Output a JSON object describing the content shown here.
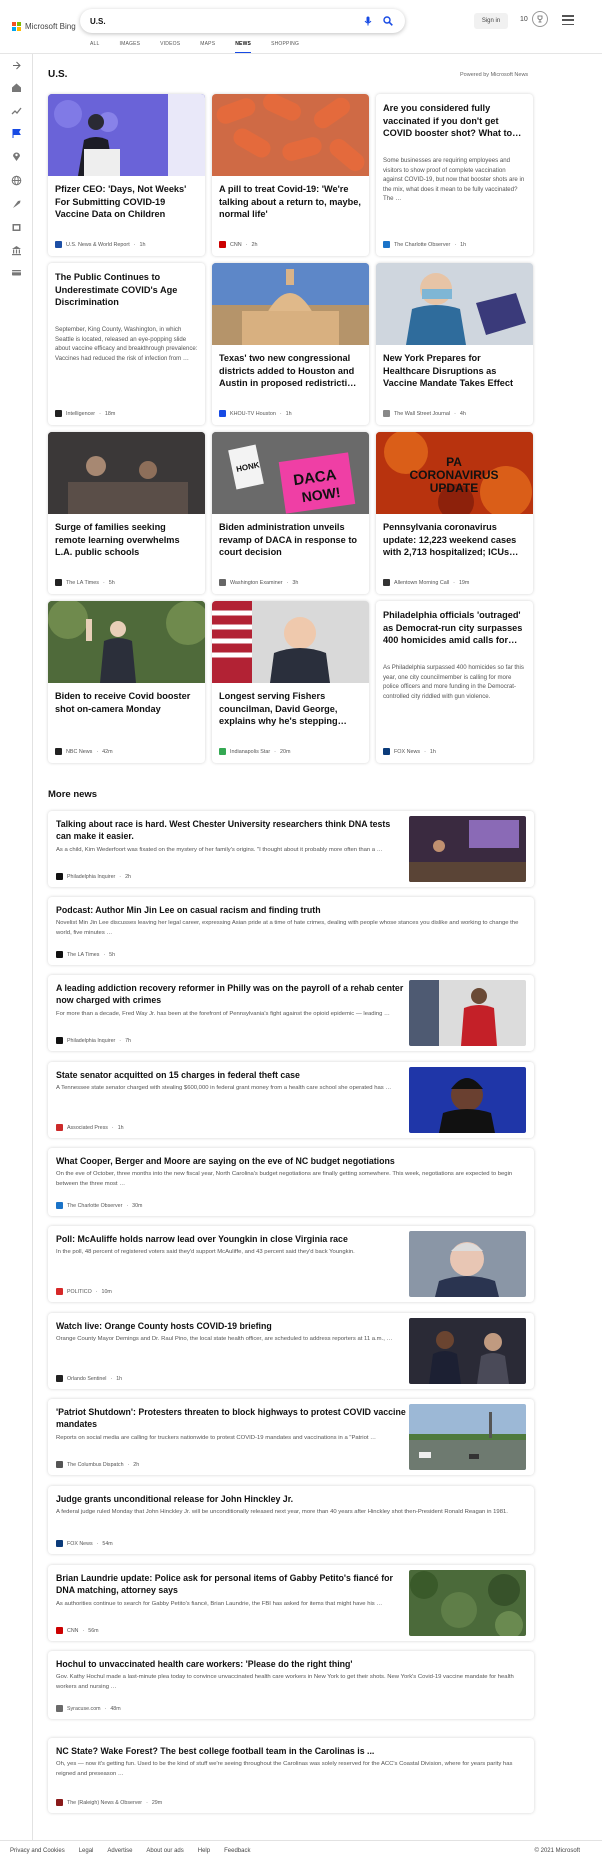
{
  "brand": {
    "name": "Microsoft Bing",
    "colors": [
      "#f25022",
      "#7fba00",
      "#00a4ef",
      "#ffb900"
    ]
  },
  "search": {
    "query": "U.S."
  },
  "header": {
    "sign_in": "Sign in",
    "rewards_count": "10"
  },
  "tabs": [
    {
      "label": "ALL",
      "active": false
    },
    {
      "label": "IMAGES",
      "active": false
    },
    {
      "label": "VIDEOS",
      "active": false
    },
    {
      "label": "MAPS",
      "active": false
    },
    {
      "label": "NEWS",
      "active": true
    },
    {
      "label": "SHOPPING",
      "active": false
    }
  ],
  "rail_icons": [
    "collapse-arrow-icon",
    "home-icon",
    "trending-icon",
    "flag-icon",
    "location-icon",
    "globe-icon",
    "rocket-icon",
    "entertainment-icon",
    "finance-icon",
    "money-icon"
  ],
  "section": {
    "title": "U.S.",
    "powered_by": "Powered by Microsoft News"
  },
  "accent": "#174ae4",
  "cards": [
    {
      "title": "Pfizer CEO: 'Days, Not Weeks' For Submitting COVID-19 Vaccine Data on Children",
      "source": "U.S. News & World Report",
      "time": "1h",
      "image": "pfizer-ceo"
    },
    {
      "title": "A pill to treat Covid-19: 'We're talking about a return to, maybe, normal life'",
      "source": "CNN",
      "time": "2h",
      "image": "pills"
    },
    {
      "title": "Are you considered fully vaccinated if you don't get COVID booster shot? What to…",
      "snippet": "Some businesses are requiring employees and visitors to show proof of complete vaccination against COVID-19, but now that booster shots are in the mix, what does it mean to be fully vaccinated? The …",
      "source": "The Charlotte Observer",
      "time": "1h"
    },
    {
      "title": "The Public Continues to Underestimate COVID's Age Discrimination",
      "snippet": "September, King County, Washington, in which Seattle is located, released an eye-popping slide about vaccine efficacy and breakthrough prevalence: Vaccines had reduced the risk of infection from …",
      "source": "Intelligencer",
      "time": "18m"
    },
    {
      "title": "Texas' two new congressional districts added to Houston and Austin in proposed redistricti…",
      "source": "KHOU-TV Houston",
      "time": "1h",
      "image": "capitol"
    },
    {
      "title": "New York Prepares for Healthcare Disruptions as Vaccine Mandate Takes Effect",
      "source": "The Wall Street Journal",
      "time": "4h",
      "image": "nurse"
    },
    {
      "title": "Surge of families seeking remote learning overwhelms L.A. public schools",
      "source": "The LA Times",
      "time": "5h",
      "image": "classroom"
    },
    {
      "title": "Biden administration unveils revamp of DACA in response to court decision",
      "source": "Washington Examiner",
      "time": "3h",
      "image": "daca"
    },
    {
      "title": "Pennsylvania coronavirus update: 12,223 weekend cases with 2,713 hospitalized; ICUs…",
      "source": "Allentown Morning Call",
      "time": "19m",
      "image": "pa-covid",
      "image_text": "PA CORONAVIRUS UPDATE"
    },
    {
      "title": "Biden to receive Covid booster shot on-camera Monday",
      "source": "NBC News",
      "time": "42m",
      "image": "biden"
    },
    {
      "title": "Longest serving Fishers councilman, David George, explains why he's stepping…",
      "source": "Indianapolis Star",
      "time": "20m",
      "image": "councilman"
    },
    {
      "title": "Philadelphia officials 'outraged' as Democrat-run city surpasses 400 homicides amid calls for…",
      "snippet": "As Philadelphia surpassed 400 homicides so far this year, one city councilmember is calling for more police officers and more funding in the Democrat-controlled city riddled with gun violence.",
      "source": "FOX News",
      "time": "1h"
    }
  ],
  "daca_signs": [
    "HONK",
    "DACA NOW!"
  ],
  "more_news": {
    "title": "More news",
    "items": [
      {
        "title": "Talking about race is hard. West Chester University researchers think DNA tests can make it easier.",
        "snippet": "As a child, Kim Wederfoort was fixated on the mystery of her family's origins. \"I thought about it probably more often than a …",
        "source": "Philadelphia Inquirer",
        "time": "2h",
        "image": "lecture"
      },
      {
        "title": "Podcast: Author Min Jin Lee on casual racism and finding truth",
        "snippet": "Novelist Min Jin Lee discusses leaving her legal career, expressing Asian pride at a time of hate crimes, dealing with people whose stances you dislike and working to change the world, five minutes …",
        "source": "The LA Times",
        "time": "5h"
      },
      {
        "title": "A leading addiction recovery reformer in Philly was on the payroll of a rehab center now charged with crimes",
        "snippet": "For more than a decade, Fred Way Jr. has been at the forefront of Pennsylvania's fight against the opioid epidemic — leading …",
        "source": "Philadelphia Inquirer",
        "time": "7h",
        "image": "red-shirt"
      },
      {
        "title": "State senator acquitted on 15 charges in federal theft case",
        "snippet": "A Tennessee state senator charged with stealing $600,000 in federal grant money from a health care school she operated has …",
        "source": "Associated Press",
        "time": "1h",
        "image": "senator"
      },
      {
        "title": "What Cooper, Berger and Moore are saying on the eve of NC budget negotiations",
        "snippet": "On the eve of October, three months into the new fiscal year, North Carolina's budget negotiations are finally getting somewhere. This week, negotiations are expected to begin between the three most …",
        "source": "The Charlotte Observer",
        "time": "30m"
      },
      {
        "title": "Poll: McAuliffe holds narrow lead over Youngkin in close Virginia race",
        "snippet": "In the poll, 48 percent of registered voters said they'd support McAuliffe, and 43 percent said they'd back Youngkin.",
        "source": "POLITICO",
        "time": "10m",
        "image": "mcauliffe"
      },
      {
        "title": "Watch live: Orange County hosts COVID-19 briefing",
        "snippet": "Orange County Mayor Demings and Dr. Raul Pino, the local state health officer, are scheduled to address reporters at 11 a.m., …",
        "source": "Orlando Sentinel",
        "time": "1h",
        "image": "briefing"
      },
      {
        "title": "'Patriot Shutdown': Protesters threaten to block highways to protest COVID vaccine mandates",
        "snippet": "Reports on social media are calling for truckers nationwide to protest COVID-19 mandates and vaccinations in a \"Patriot …",
        "source": "The Columbus Dispatch",
        "time": "2h",
        "image": "highway"
      },
      {
        "title": "Judge grants unconditional release for John Hinckley Jr.",
        "snippet": "A federal judge ruled Monday that John Hinckley Jr. will be unconditionally released next year, more than 40 years after Hinckley shot then-President Ronald Reagan in 1981.",
        "source": "FOX News",
        "time": "54m"
      },
      {
        "title": "Brian Laundrie update: Police ask for personal items of Gabby Petito's fiancé for DNA matching, attorney says",
        "snippet": "As authorities continue to search for Gabby Petito's fiancé, Brian Laundrie, the FBI has asked for items that might have his …",
        "source": "CNN",
        "time": "56m",
        "image": "forest"
      },
      {
        "title": "Hochul to unvaccinated health care workers: 'Please do the right thing'",
        "snippet": "Gov. Kathy Hochul made a last-minute plea today to convince unvaccinated health care workers in New York to get their shots. New York's Covid-19 vaccine mandate for health workers and nursing …",
        "source": "Syracuse.com",
        "time": "48m"
      },
      {
        "title": "NC State? Wake Forest? The best college football team in the Carolinas is ...",
        "snippet": "Oh, yes — now it's getting fun. Used to be the kind of stuff we're seeing throughout the Carolinas was solely reserved for the ACC's Coastal Division, where for years parity has reigned and preseason …",
        "source": "The (Raleigh) News & Observer",
        "time": "29m"
      }
    ]
  },
  "footer": {
    "links": [
      "Privacy and Cookies",
      "Legal",
      "Advertise",
      "About our ads",
      "Help",
      "Feedback"
    ],
    "copyright": "© 2021 Microsoft"
  }
}
